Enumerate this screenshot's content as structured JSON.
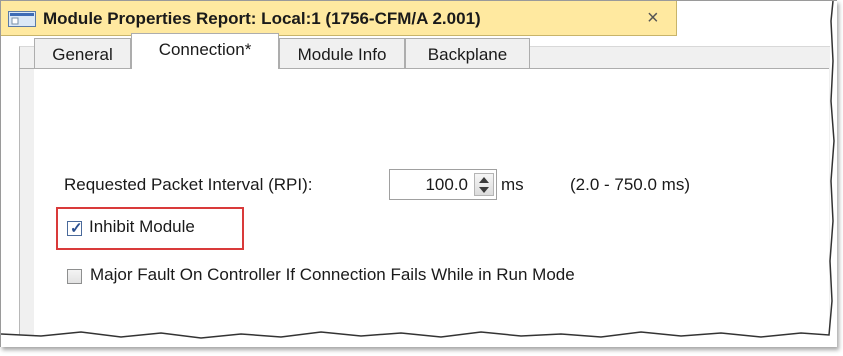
{
  "window": {
    "title": "Module Properties Report: Local:1 (1756-CFM/A 2.001)",
    "close_glyph": "×",
    "icon": "module-window-icon"
  },
  "tabs": [
    {
      "label": "General",
      "active": false
    },
    {
      "label": "Connection*",
      "active": true
    },
    {
      "label": "Module Info",
      "active": false
    },
    {
      "label": "Backplane",
      "active": false
    }
  ],
  "connection": {
    "rpi_label": "Requested Packet Interval (RPI):",
    "rpi_value": "100.0",
    "rpi_unit": "ms",
    "rpi_range": "(2.0 - 750.0 ms)",
    "inhibit_label": "Inhibit Module",
    "inhibit_checked": true,
    "major_fault_label": "Major Fault On Controller If Connection Fails While in Run Mode",
    "major_fault_checked": false
  },
  "colors": {
    "title_bar": "#ffe9a0",
    "highlight_box": "#d93a3a",
    "check_color": "#2a4f8f"
  }
}
